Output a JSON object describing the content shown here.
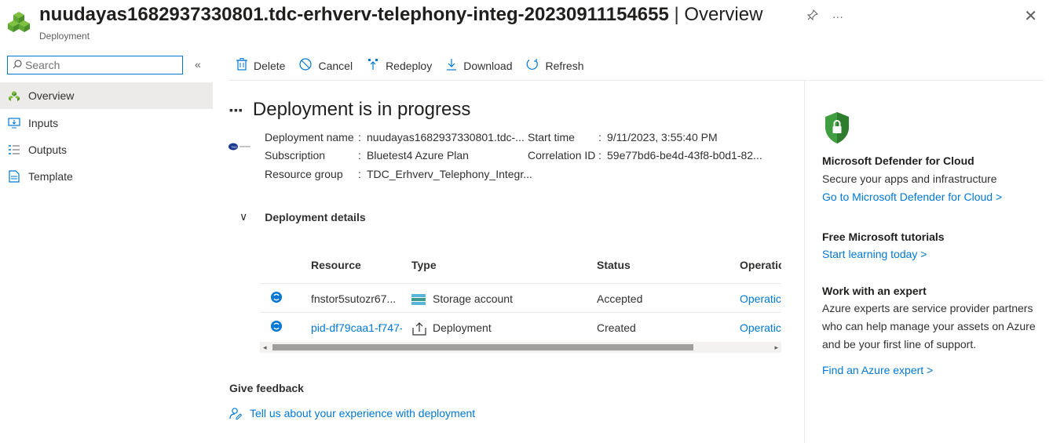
{
  "header": {
    "title": "nuudayas1682937330801.tdc-erhverv-telephony-integ-20230911154655",
    "separator": "|",
    "section": "Overview",
    "subtitle": "Deployment",
    "pin_icon": "pin-icon",
    "more_label": "···",
    "close_label": "✕"
  },
  "search": {
    "placeholder": "Search",
    "value": ""
  },
  "sidebar": {
    "collapse_label": "«",
    "items": [
      {
        "label": "Overview",
        "icon": "overview-icon",
        "selected": true
      },
      {
        "label": "Inputs",
        "icon": "inputs-icon",
        "selected": false
      },
      {
        "label": "Outputs",
        "icon": "outputs-icon",
        "selected": false
      },
      {
        "label": "Template",
        "icon": "template-icon",
        "selected": false
      }
    ]
  },
  "toolbar": {
    "delete_label": "Delete",
    "cancel_label": "Cancel",
    "redeploy_label": "Redeploy",
    "download_label": "Download",
    "refresh_label": "Refresh"
  },
  "status": {
    "dots": "▪▪▪",
    "title": "Deployment is in progress"
  },
  "info": {
    "deployment_name_label": "Deployment name",
    "deployment_name_value": "nuudayas1682937330801.tdc-...",
    "subscription_label": "Subscription",
    "subscription_value": "Bluetest4 Azure Plan",
    "resource_group_label": "Resource group",
    "resource_group_value": "TDC_Erhverv_Telephony_Integr...",
    "start_time_label": "Start time",
    "start_time_value": "9/11/2023, 3:55:40 PM",
    "correlation_label": "Correlation ID",
    "correlation_value": "59e77bd6-be4d-43f8-b0d1-82...",
    "colon": ":"
  },
  "details": {
    "chevron": "∨",
    "title": "Deployment details",
    "columns": [
      "Resource",
      "Type",
      "Status",
      "Operatic"
    ],
    "rows": [
      {
        "resource": "fnstor5sutozr67...",
        "resource_is_link": false,
        "type": "Storage account",
        "type_icon": "storage-account-icon",
        "status": "Accepted",
        "operation": "Operatic"
      },
      {
        "resource": "pid-df79caa1-f747-",
        "resource_is_link": true,
        "type": "Deployment",
        "type_icon": "deployment-icon",
        "status": "Created",
        "operation": "Operatic"
      }
    ],
    "scroll_left": "◂",
    "scroll_right": "▸"
  },
  "feedback": {
    "title": "Give feedback",
    "link": "Tell us about your experience with deployment"
  },
  "side": {
    "defender_title": "Microsoft Defender for Cloud",
    "defender_desc": "Secure your apps and infrastructure",
    "defender_link": "Go to Microsoft Defender for Cloud >",
    "tutorials_title": "Free Microsoft tutorials",
    "tutorials_link": "Start learning today >",
    "expert_title": "Work with an expert",
    "expert_desc_1": "Azure experts are service provider partners",
    "expert_desc_2": "who can help manage your assets on Azure",
    "expert_desc_3": "and be your first line of support.",
    "expert_link": "Find an Azure expert >"
  },
  "colors": {
    "accent": "#0078d4",
    "selected_bg": "#edebe9",
    "shield_green": "#3f9e3f",
    "cube_green": "#5ea833"
  }
}
